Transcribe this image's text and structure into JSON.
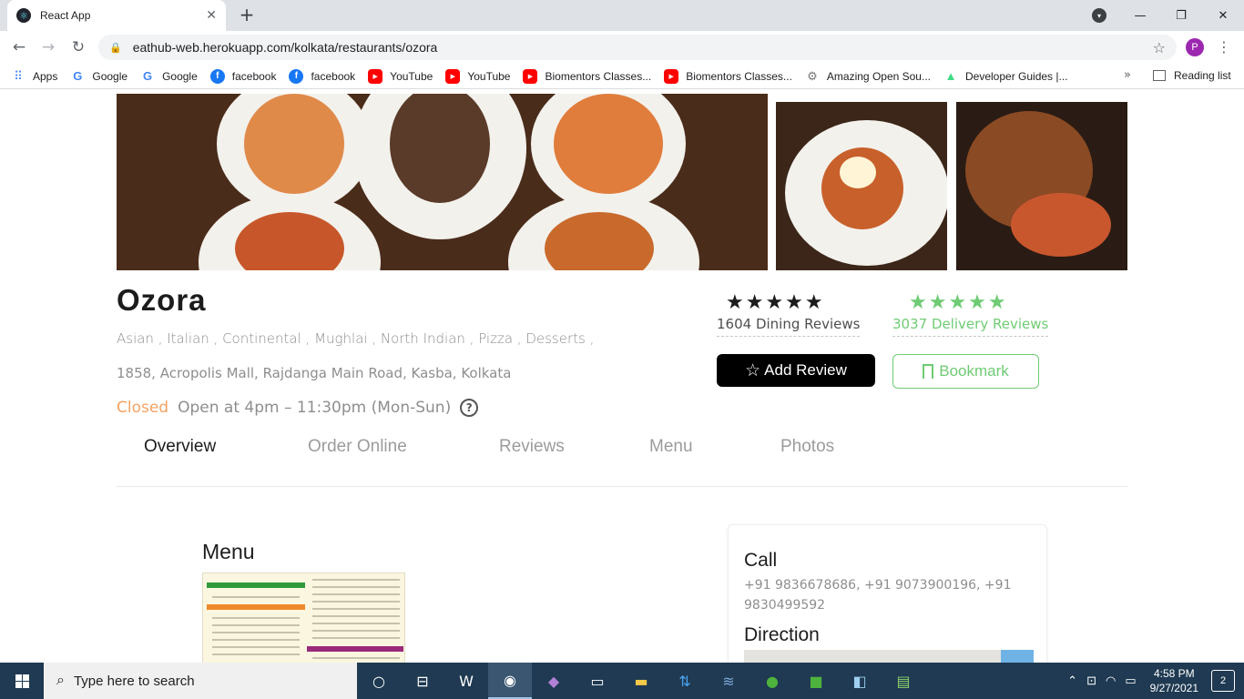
{
  "browser": {
    "tab_title": "React App",
    "url": "eathub-web.herokuapp.com/kolkata/restaurants/ozora",
    "profile_initial": "P",
    "bookmarks": [
      {
        "label": "Apps",
        "icon": "apps-grid-icon"
      },
      {
        "label": "Google",
        "icon": "google-icon"
      },
      {
        "label": "Google",
        "icon": "google-icon"
      },
      {
        "label": "facebook",
        "icon": "facebook-icon"
      },
      {
        "label": "facebook",
        "icon": "facebook-icon"
      },
      {
        "label": "YouTube",
        "icon": "youtube-icon"
      },
      {
        "label": "YouTube",
        "icon": "youtube-icon"
      },
      {
        "label": "Biomentors Classes...",
        "icon": "youtube-icon"
      },
      {
        "label": "Biomentors Classes...",
        "icon": "youtube-icon"
      },
      {
        "label": "Amazing Open Sou...",
        "icon": "opensource-icon"
      },
      {
        "label": "Developer Guides |...",
        "icon": "android-icon"
      }
    ],
    "bookmarks_more": "»",
    "reading_list": "Reading list"
  },
  "restaurant": {
    "name": "Ozora",
    "cuisines": "Asian , Italian , Continental , Mughlai , North Indian , Pizza , Desserts ,",
    "address": "1858, Acropolis Mall, Rajdanga Main Road, Kasba, Kolkata",
    "status": "Closed",
    "timing": "Open at 4pm – 11:30pm (Mon-Sun)",
    "help_glyph": "?",
    "dining": {
      "stars": "★★★★★",
      "rating": 5,
      "label": "1604 Dining Reviews"
    },
    "delivery": {
      "stars": "★★★★★",
      "rating": 5,
      "label": "3037 Delivery Reviews"
    },
    "add_review": "Add Review",
    "bookmark": "Bookmark",
    "colors": {
      "status_closed": "#f4a262",
      "accent_green": "#6fcb74"
    }
  },
  "tabs": [
    "Overview",
    "Order Online",
    "Reviews",
    "Menu",
    "Photos"
  ],
  "overview": {
    "menu_title": "Menu",
    "call_heading": "Call",
    "call_numbers": "+91 9836678686, +91 9073900196, +91 9830499592",
    "direction_heading": "Direction"
  },
  "taskbar": {
    "search_placeholder": "Type here to search",
    "time": "4:58 PM",
    "date": "9/27/2021",
    "notifications": "2",
    "apps": [
      "cortana-icon",
      "task-view-icon",
      "word-icon",
      "chrome-icon",
      "visual-studio-icon",
      "terminal-icon",
      "file-explorer-icon",
      "store-icon",
      "vscode-icon",
      "mongodb-icon",
      "mongodb-compass-icon",
      "notes-icon",
      "taskmanager-icon"
    ]
  }
}
